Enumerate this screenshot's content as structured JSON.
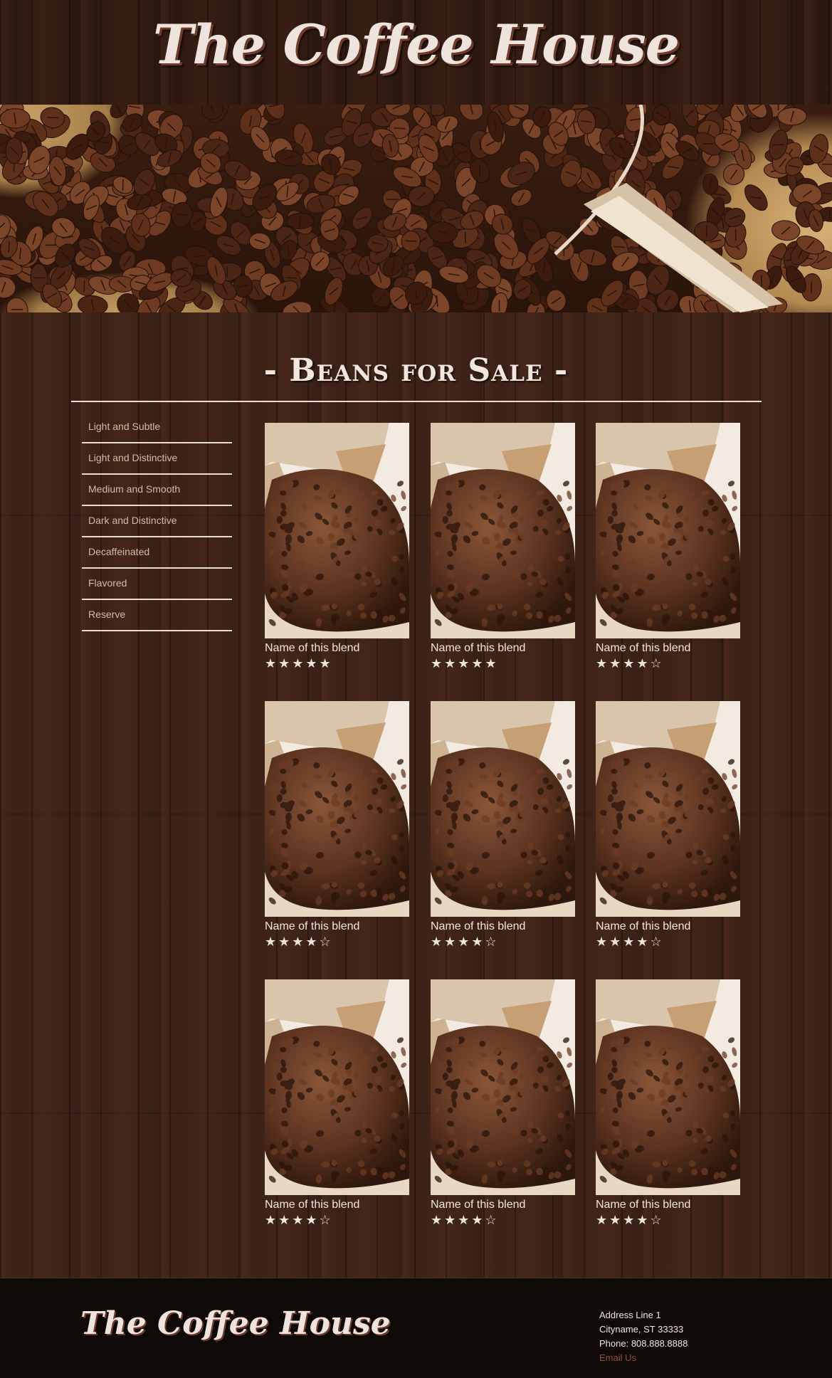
{
  "site": {
    "title": "The Coffee House"
  },
  "section": {
    "title": "- Beans for Sale -"
  },
  "categories": [
    {
      "label": "Light and Subtle"
    },
    {
      "label": "Light and Distinctive"
    },
    {
      "label": "Medium and Smooth"
    },
    {
      "label": "Dark and Distinctive"
    },
    {
      "label": "Decaffeinated"
    },
    {
      "label": "Flavored"
    },
    {
      "label": "Reserve"
    }
  ],
  "products": [
    {
      "name": "Name of this blend",
      "stars": "★★★★★",
      "rating": 5
    },
    {
      "name": "Name of this blend",
      "stars": "★★★★★",
      "rating": 5
    },
    {
      "name": "Name of this blend",
      "stars": "★★★★☆",
      "rating": 4
    },
    {
      "name": "Name of this blend",
      "stars": "★★★★☆",
      "rating": 4
    },
    {
      "name": "Name of this blend",
      "stars": "★★★★☆",
      "rating": 4
    },
    {
      "name": "Name of this blend",
      "stars": "★★★★☆",
      "rating": 4
    },
    {
      "name": "Name of this blend",
      "stars": "★★★★☆",
      "rating": 4
    },
    {
      "name": "Name of this blend",
      "stars": "★★★★☆",
      "rating": 4
    },
    {
      "name": "Name of this blend",
      "stars": "★★★★☆",
      "rating": 4
    }
  ],
  "footer": {
    "logo": "The Coffee House",
    "address_line_1": "Address Line 1",
    "address_line_2": "Cityname, ST 33333",
    "phone": "Phone: 808.888.8888",
    "email": "Email Us"
  },
  "colors": {
    "background": "#3b2117",
    "text_light": "#f2e6df",
    "nav_text": "#d7b9aa",
    "accent_link": "#9a4e37",
    "footer_bg": "#0f0907"
  }
}
